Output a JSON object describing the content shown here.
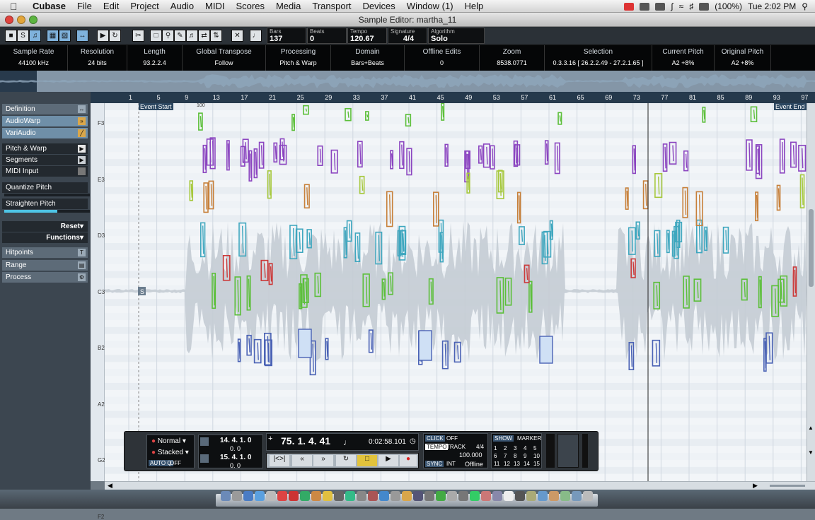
{
  "menubar": {
    "app": "Cubase",
    "items": [
      "File",
      "Edit",
      "Project",
      "Audio",
      "MIDI",
      "Scores",
      "Media",
      "Transport",
      "Devices",
      "Window (1)",
      "Help"
    ],
    "battery": "(100%)",
    "clock": "Tue 2:02 PM"
  },
  "window": {
    "title": "Sample Editor: martha_11"
  },
  "toolbar": {
    "fields": [
      {
        "label": "Bars",
        "value": "137"
      },
      {
        "label": "Beats",
        "value": "0"
      },
      {
        "label": "Tempo",
        "value": "120.67"
      },
      {
        "label": "Signature",
        "value": "4/4"
      },
      {
        "label": "Algorithm",
        "value": "Solo"
      }
    ]
  },
  "info": [
    {
      "label": "Sample Rate",
      "value": "44100        kHz"
    },
    {
      "label": "Resolution",
      "value": "24          bits"
    },
    {
      "label": "Length",
      "value": "93.2.2.4"
    },
    {
      "label": "Global Transpose",
      "value": "Follow"
    },
    {
      "label": "Processing",
      "value": "Pitch & Warp"
    },
    {
      "label": "Domain",
      "value": "Bars+Beats"
    },
    {
      "label": "Offline Edits",
      "value": "0"
    },
    {
      "label": "Zoom",
      "value": "8538.0771"
    },
    {
      "label": "Selection",
      "value": "0.3.3.16 [ 26.2.2.49 - 27.2.1.65 ]"
    },
    {
      "label": "Current Pitch",
      "value": "A2  +8%"
    },
    {
      "label": "Original Pitch",
      "value": "A2  +8%"
    }
  ],
  "inspector": {
    "sections": [
      "Definition",
      "AudioWarp",
      "VariAudio"
    ],
    "vari": [
      "Pitch & Warp",
      "Segments",
      "MIDI Input"
    ],
    "quantize": "Quantize Pitch",
    "straighten": "Straighten Pitch",
    "straighten_level": 0.62,
    "reset": "Reset",
    "functions": "Functions",
    "bottom": [
      "Hitpoints",
      "Range",
      "Process"
    ]
  },
  "ruler": {
    "bars": [
      "1",
      "5",
      "9",
      "13",
      "17",
      "21",
      "25",
      "29",
      "33",
      "37",
      "41",
      "45",
      "49",
      "53",
      "57",
      "61",
      "65",
      "69",
      "73",
      "77",
      "81",
      "85",
      "89",
      "93",
      "97"
    ],
    "event_start": "Event Start",
    "event_end": "Event End",
    "marker": "100"
  },
  "pitches": [
    "F3",
    "E3",
    "D3",
    "C3",
    "B2",
    "A2",
    "G2",
    "F2"
  ],
  "editor": {
    "segment_flag": "S"
  },
  "transport": {
    "mode1": "Normal",
    "mode2": "Stacked",
    "autoq": "AUTO Q",
    "autoq_val": "OFF",
    "left_locator": "14.  4.  1.    0",
    "left_sub": "0.    0",
    "right_locator": "15.  4.  1.    0",
    "right_sub": "0.    0",
    "position": "75.  1.  4.  41",
    "time": "0:02:58.101",
    "click": "CLICK",
    "click_val": "OFF",
    "tempo": "TEMPO",
    "track": "TRACK",
    "sig": "4/4",
    "tempo_val": "100.000",
    "sync": "SYNC",
    "int": "INT",
    "offline": "Offline",
    "show": "SHOW",
    "marker": "MARKER",
    "markers": [
      "1",
      "2",
      "3",
      "4",
      "5",
      "6",
      "7",
      "8",
      "9",
      "10",
      "11",
      "12",
      "13",
      "14",
      "15"
    ]
  },
  "colors": {
    "purple": "#8b45c0",
    "cyan": "#3fa7bf",
    "green": "#5cbf3a",
    "blue": "#4a62b5",
    "orange": "#c7803a",
    "red": "#cc3a3a",
    "lime": "#a6c83c"
  }
}
